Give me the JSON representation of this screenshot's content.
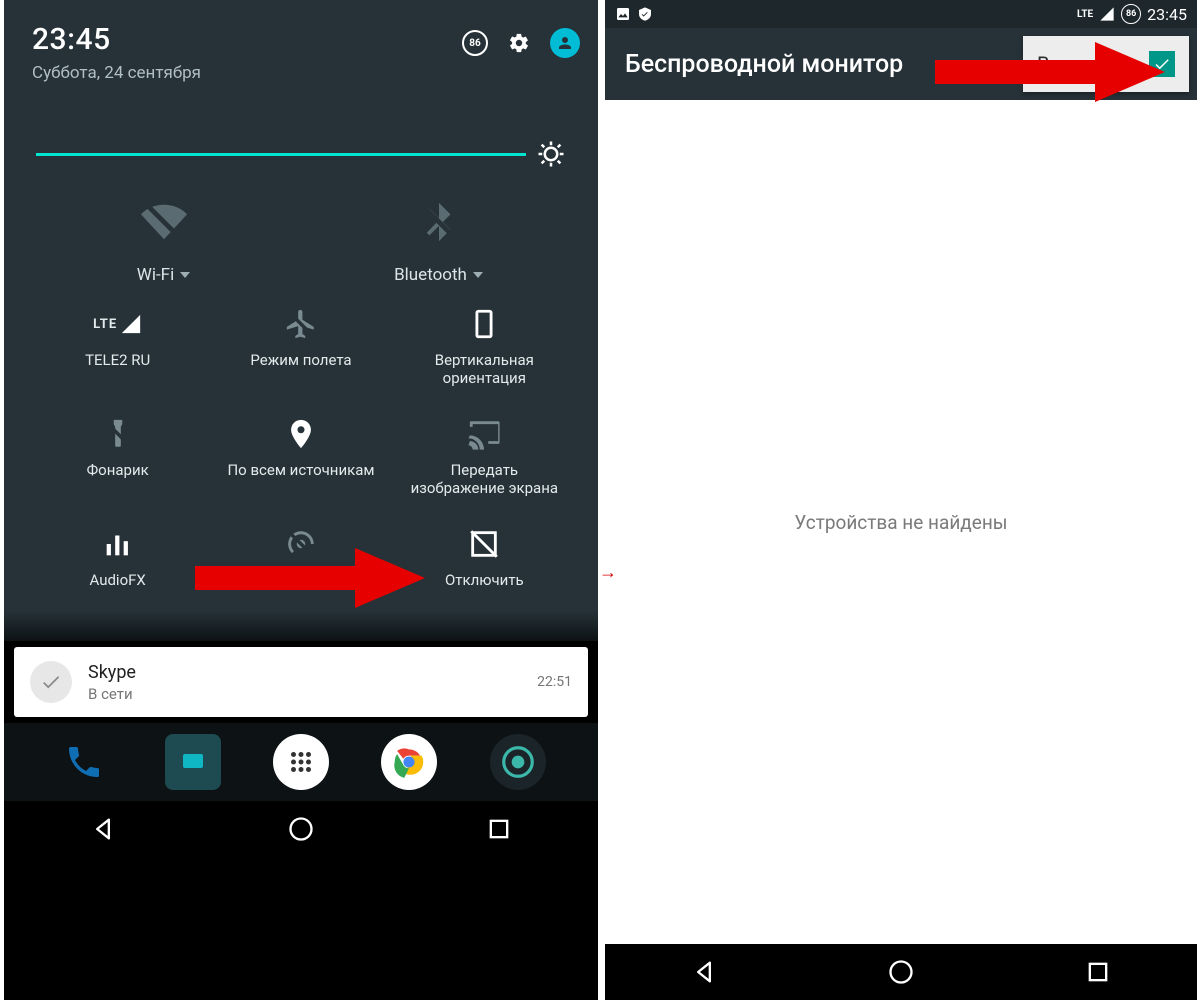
{
  "left": {
    "header": {
      "time": "23:45",
      "date": "Суббота, 24 сентября",
      "battery_pct": "86"
    },
    "top_tiles": {
      "wifi_label": "Wi-Fi",
      "bt_label": "Bluetooth"
    },
    "grid": {
      "cell_lte": "LTE",
      "cellular_label": "TELE2 RU",
      "airplane_label": "Режим полета",
      "rotation_label_1": "Вертикальная",
      "rotation_label_2": "ориентация",
      "flashlight_label": "Фонарик",
      "location_label": "По всем источникам",
      "cast_label_1": "Передать",
      "cast_label_2": "изображение экрана",
      "audiofx_label": "AudioFX",
      "hotspot_label": "Точка доступа",
      "disable_label": "Отключить"
    },
    "notification": {
      "title": "Skype",
      "subtitle": "В сети",
      "time": "22:51"
    }
  },
  "right": {
    "statusbar": {
      "lte": "LTE",
      "battery_pct": "86",
      "time": "23:45"
    },
    "header": {
      "title": "Беспроводной монитор",
      "enable_label": "Включить"
    },
    "body": {
      "empty": "Устройства не найдены"
    }
  }
}
